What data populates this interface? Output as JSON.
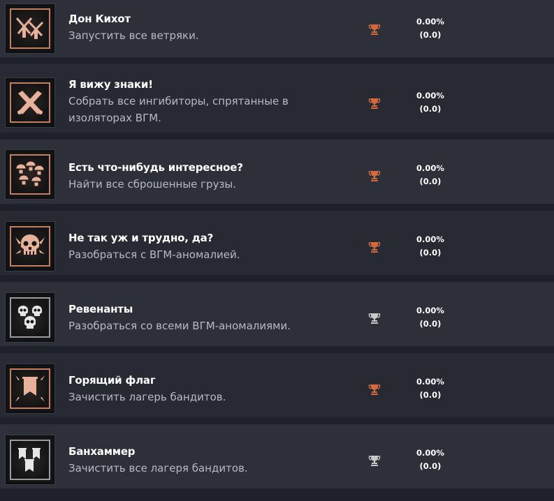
{
  "colors": {
    "bronze": "#d5693c",
    "silver": "#c8c8c8",
    "icon_frame": "#c47e63"
  },
  "achievements": [
    {
      "title": "Дон Кихот",
      "description": "Запустить все ветряки.",
      "percent": "0.00%",
      "count": "(0.0)",
      "trophy": "bronze",
      "icon": "windmills-icon"
    },
    {
      "title": "Я вижу знаки!",
      "description": "Собрать все ингибиторы, спрятанные в изоляторах ВГМ.",
      "percent": "0.00%",
      "count": "(0.0)",
      "trophy": "bronze",
      "icon": "crossed-tools-icon"
    },
    {
      "title": "Есть что-нибудь интересное?",
      "description": "Найти все сброшенные грузы.",
      "percent": "0.00%",
      "count": "(0.0)",
      "trophy": "bronze",
      "icon": "parachutes-icon"
    },
    {
      "title": "Не так уж и трудно, да?",
      "description": "Разобраться с ВГМ-аномалией.",
      "percent": "0.00%",
      "count": "(0.0)",
      "trophy": "bronze",
      "icon": "skull-icon"
    },
    {
      "title": "Ревенанты",
      "description": "Разобраться со всеми ВГМ-аномалиями.",
      "percent": "0.00%",
      "count": "(0.0)",
      "trophy": "silver",
      "icon": "skulls-group-icon"
    },
    {
      "title": "Горящий флаг",
      "description": "Зачистить лагерь бандитов.",
      "percent": "0.00%",
      "count": "(0.0)",
      "trophy": "bronze",
      "icon": "banner-icon"
    },
    {
      "title": "Банхаммер",
      "description": "Зачистить все лагеря бандитов.",
      "percent": "0.00%",
      "count": "(0.0)",
      "trophy": "silver",
      "icon": "banners-icon"
    }
  ]
}
